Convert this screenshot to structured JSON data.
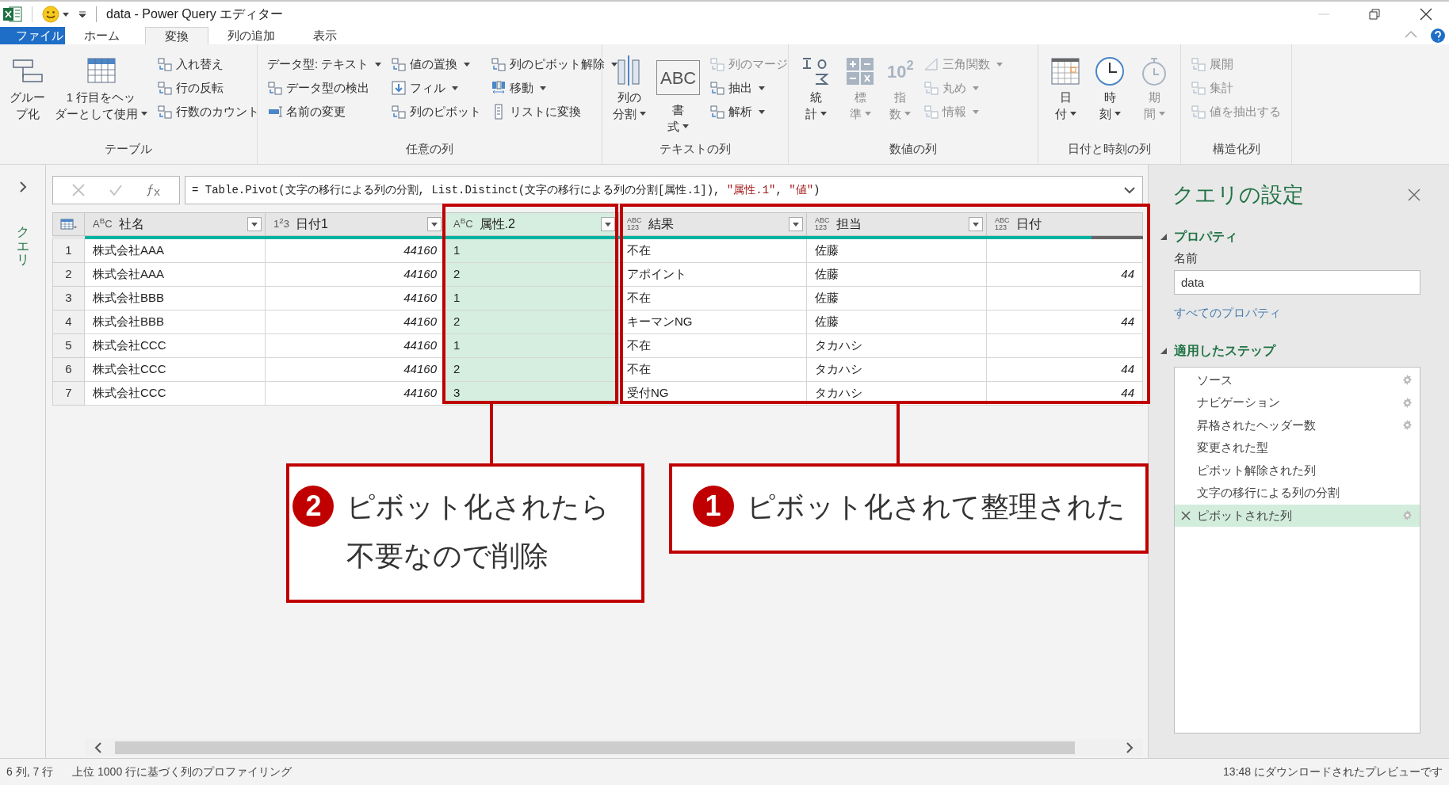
{
  "window": {
    "title": "data - Power Query エディター"
  },
  "tabs": [
    {
      "label": "ファイル",
      "selected": false,
      "kind": "file"
    },
    {
      "label": "ホーム",
      "selected": false,
      "kind": "tab"
    },
    {
      "label": "変換",
      "selected": true,
      "kind": "tab"
    },
    {
      "label": "列の追加",
      "selected": false,
      "kind": "tab"
    },
    {
      "label": "表示",
      "selected": false,
      "kind": "tab"
    }
  ],
  "ribbon_groups": [
    {
      "label": "テーブル",
      "items": [
        {
          "kind": "large",
          "lines": [
            "グルー",
            "プ化"
          ],
          "dropdown": false,
          "disabled": false
        },
        {
          "kind": "large",
          "lines": [
            "1 行目をヘッ",
            "ダーとして使用"
          ],
          "dropdown": true,
          "disabled": false
        },
        {
          "kind": "stack",
          "items": [
            {
              "label": "入れ替え",
              "dropdown": false,
              "disabled": false
            },
            {
              "label": "行の反転",
              "dropdown": false,
              "disabled": false
            },
            {
              "label": "行数のカウント",
              "dropdown": false,
              "disabled": false
            }
          ]
        }
      ]
    },
    {
      "label": "任意の列",
      "items": [
        {
          "kind": "stack",
          "items": [
            {
              "label": "データ型: テキスト",
              "dropdown": true,
              "disabled": false
            },
            {
              "label": "データ型の検出",
              "dropdown": false,
              "disabled": false
            },
            {
              "label": "名前の変更",
              "dropdown": false,
              "disabled": false
            }
          ]
        },
        {
          "kind": "stack",
          "items": [
            {
              "label": "値の置換",
              "dropdown": true,
              "disabled": false
            },
            {
              "label": "フィル",
              "dropdown": true,
              "disabled": false
            },
            {
              "label": "列のピボット",
              "dropdown": false,
              "disabled": false
            }
          ]
        },
        {
          "kind": "stack",
          "items": [
            {
              "label": "列のピボット解除",
              "dropdown": true,
              "disabled": false
            },
            {
              "label": "移動",
              "dropdown": true,
              "disabled": false
            },
            {
              "label": "リストに変換",
              "dropdown": false,
              "disabled": false
            }
          ]
        }
      ]
    },
    {
      "label": "テキストの列",
      "items": [
        {
          "kind": "large",
          "lines": [
            "列の",
            "分割"
          ],
          "dropdown": true,
          "disabled": false
        },
        {
          "kind": "large",
          "lines": [
            "書",
            "式"
          ],
          "dropdown": true,
          "disabled": false,
          "icon_text": "ABC"
        },
        {
          "kind": "stack",
          "items": [
            {
              "label": "列のマージ",
              "dropdown": false,
              "disabled": true
            },
            {
              "label": "抽出",
              "dropdown": true,
              "disabled": false
            },
            {
              "label": "解析",
              "dropdown": true,
              "disabled": false
            }
          ]
        }
      ]
    },
    {
      "label": "数値の列",
      "items": [
        {
          "kind": "large",
          "lines": [
            "統",
            "計"
          ],
          "dropdown": true,
          "disabled": false
        },
        {
          "kind": "large",
          "lines": [
            "標",
            "準"
          ],
          "dropdown": true,
          "disabled": true
        },
        {
          "kind": "large",
          "lines": [
            "指",
            "数"
          ],
          "dropdown": true,
          "disabled": true,
          "icon_text": "10$^{2}$"
        },
        {
          "kind": "stack",
          "items": [
            {
              "label": "三角関数",
              "dropdown": true,
              "disabled": true
            },
            {
              "label": "丸め",
              "dropdown": true,
              "disabled": true
            },
            {
              "label": "情報",
              "dropdown": true,
              "disabled": true
            }
          ]
        }
      ]
    },
    {
      "label": "日付と時刻の列",
      "items": [
        {
          "kind": "large",
          "lines": [
            "日",
            "付"
          ],
          "dropdown": true,
          "disabled": false
        },
        {
          "kind": "large",
          "lines": [
            "時",
            "刻"
          ],
          "dropdown": true,
          "disabled": false
        },
        {
          "kind": "large",
          "lines": [
            "期",
            "間"
          ],
          "dropdown": true,
          "disabled": true
        }
      ]
    },
    {
      "label": "構造化列",
      "items": [
        {
          "kind": "stack",
          "items": [
            {
              "label": "展開",
              "dropdown": false,
              "disabled": true
            },
            {
              "label": "集計",
              "dropdown": false,
              "disabled": true
            },
            {
              "label": "値を抽出する",
              "dropdown": false,
              "disabled": true
            }
          ]
        }
      ]
    }
  ],
  "query_pane": {
    "label": "クエリ",
    "expanded": false
  },
  "formula": [
    {
      "kind": "code",
      "text": "= Table.Pivot(文字の移行による列の分割, List.Distinct(文字の移行による列の分割[属性.1]), "
    },
    {
      "kind": "string",
      "text": "\"属性.1\""
    },
    {
      "kind": "code",
      "text": ", "
    },
    {
      "kind": "string",
      "text": "\"値\""
    },
    {
      "kind": "code",
      "text": ")"
    }
  ],
  "table": {
    "columns": [
      {
        "name": "社名",
        "type_label": [
          "A$^{B}$C"
        ],
        "filter": true,
        "selected": false,
        "numeric": false,
        "level": 1
      },
      {
        "name": "日付1",
        "type_label": [
          "1$^{2}$3"
        ],
        "filter": true,
        "selected": false,
        "numeric": true,
        "level": 1
      },
      {
        "name": "属性.2",
        "type_label": [
          "A$^{B}$C"
        ],
        "filter": true,
        "selected": true,
        "numeric": false,
        "level": 1
      },
      {
        "name": "結果",
        "type_label": [
          "ABC",
          "123"
        ],
        "filter": true,
        "selected": false,
        "numeric": false,
        "level": 1
      },
      {
        "name": "担当",
        "type_label": [
          "ABC",
          "123"
        ],
        "filter": true,
        "selected": false,
        "numeric": false,
        "level": 1
      },
      {
        "name": "日付",
        "type_label": [
          "ABC",
          "123"
        ],
        "filter": false,
        "selected": false,
        "numeric": true,
        "level": 0.67
      }
    ],
    "rows": [
      {
        "number": "1",
        "cells": [
          "株式会社AAA",
          "44160",
          "1",
          "不在",
          "佐藤",
          null
        ]
      },
      {
        "number": "2",
        "cells": [
          "株式会社AAA",
          "44160",
          "2",
          "アポイント",
          "佐藤",
          "44"
        ]
      },
      {
        "number": "3",
        "cells": [
          "株式会社BBB",
          "44160",
          "1",
          "不在",
          "佐藤",
          null
        ]
      },
      {
        "number": "4",
        "cells": [
          "株式会社BBB",
          "44160",
          "2",
          "キーマンNG",
          "佐藤",
          "44"
        ]
      },
      {
        "number": "5",
        "cells": [
          "株式会社CCC",
          "44160",
          "1",
          "不在",
          "タカハシ",
          null
        ]
      },
      {
        "number": "6",
        "cells": [
          "株式会社CCC",
          "44160",
          "2",
          "不在",
          "タカハシ",
          "44"
        ]
      },
      {
        "number": "7",
        "cells": [
          "株式会社CCC",
          "44160",
          "3",
          "受付NG",
          "タカハシ",
          "44"
        ]
      }
    ]
  },
  "callouts": [
    {
      "number": "2",
      "text": "ピボット化されたら不要なので削除"
    },
    {
      "number": "1",
      "text": "ピボット化されて整理された"
    }
  ],
  "settings": {
    "title": "クエリの設定",
    "properties": {
      "heading": "プロパティ",
      "expanded": true,
      "name_label": "名前",
      "name_value": "data",
      "link": "すべてのプロパティ"
    },
    "steps_heading": "適用したステップ",
    "steps_expanded": true,
    "steps": [
      {
        "label": "ソース",
        "settings": true,
        "selected": false
      },
      {
        "label": "ナビゲーション",
        "settings": true,
        "selected": false
      },
      {
        "label": "昇格されたヘッダー数",
        "settings": true,
        "selected": false
      },
      {
        "label": "変更された型",
        "settings": false,
        "selected": false
      },
      {
        "label": "ピボット解除された列",
        "settings": false,
        "selected": false
      },
      {
        "label": "文字の移行による列の分割",
        "settings": false,
        "selected": false
      },
      {
        "label": "ピボットされた列",
        "settings": true,
        "selected": true
      }
    ]
  },
  "status_bar": {
    "counts": "6 列, 7 行",
    "profiling": "上位 1000 行に基づく列のプロファイリング",
    "preview": "13:48 にダウンロードされたプレビューです"
  }
}
